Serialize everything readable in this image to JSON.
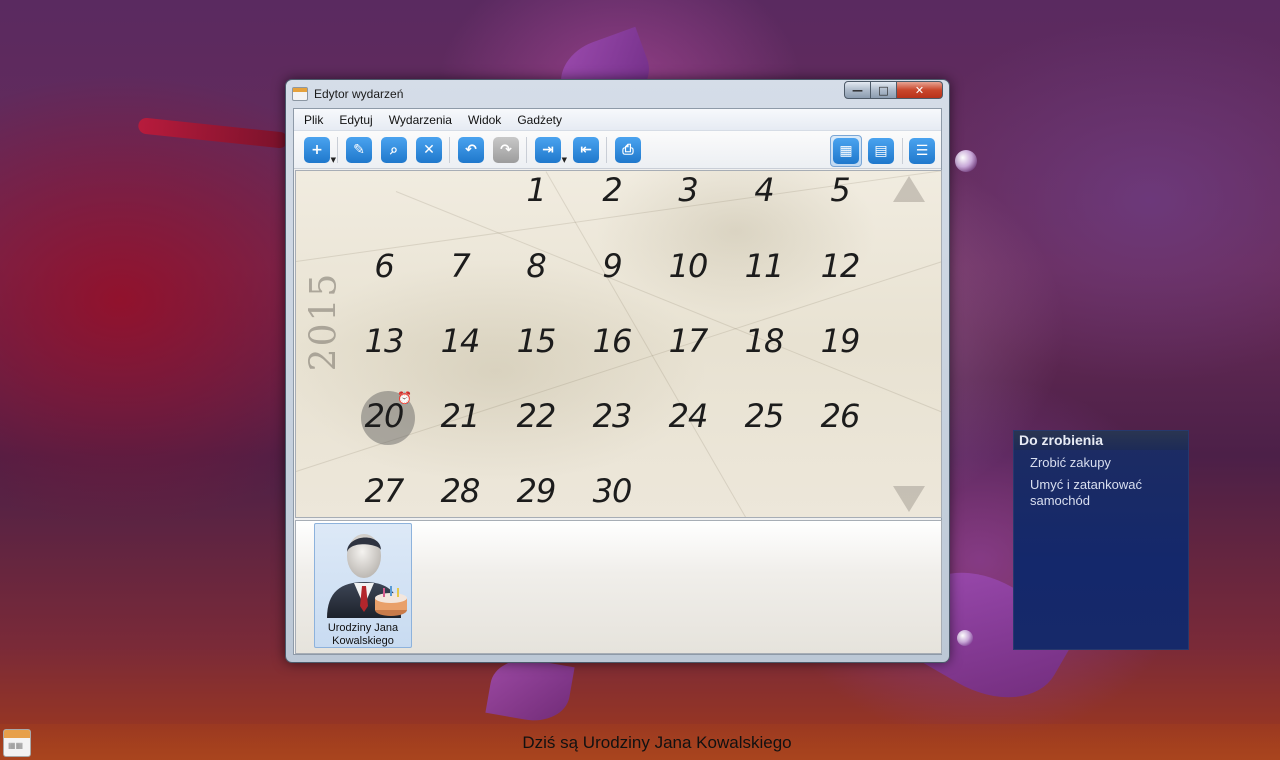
{
  "window": {
    "title": "Edytor wydarzeń",
    "controls": {
      "minimize": "—",
      "maximize": "□",
      "close": "✕"
    }
  },
  "menu": [
    "Plik",
    "Edytuj",
    "Wydarzenia",
    "Widok",
    "Gadżety"
  ],
  "toolbar": {
    "buttons": [
      {
        "name": "add-event-button",
        "icon": "plus-icon",
        "glyph": "+",
        "has_dropdown": true
      },
      {
        "name": "edit-button",
        "icon": "pencil-icon",
        "glyph": "✎"
      },
      {
        "name": "search-button",
        "icon": "magnifier-icon",
        "glyph": "⌕"
      },
      {
        "name": "delete-button",
        "icon": "x-icon",
        "glyph": "✕"
      },
      {
        "name": "undo-button",
        "icon": "undo-icon",
        "glyph": "↶"
      },
      {
        "name": "redo-button",
        "icon": "redo-icon",
        "glyph": "↷",
        "disabled": true
      },
      {
        "name": "export-button",
        "icon": "export-icon",
        "glyph": "⇥",
        "has_dropdown": true
      },
      {
        "name": "import-button",
        "icon": "import-icon",
        "glyph": "⇤"
      },
      {
        "name": "print-button",
        "icon": "printer-icon",
        "glyph": "⎙"
      }
    ],
    "view_buttons": [
      {
        "name": "month-view-button",
        "icon": "calendar-grid-icon",
        "glyph": "▦",
        "active": true
      },
      {
        "name": "week-view-button",
        "icon": "calendar-table-icon",
        "glyph": "▤"
      },
      {
        "name": "list-view-button",
        "icon": "tree-list-icon",
        "glyph": "☰"
      }
    ]
  },
  "calendar": {
    "year": "2015",
    "today": "20",
    "days": [
      [
        "",
        "",
        "1",
        "2",
        "3",
        "4",
        "5"
      ],
      [
        "6",
        "7",
        "8",
        "9",
        "10",
        "11",
        "12"
      ],
      [
        "13",
        "14",
        "15",
        "16",
        "17",
        "18",
        "19"
      ],
      [
        "20",
        "21",
        "22",
        "23",
        "24",
        "25",
        "26"
      ],
      [
        "27",
        "28",
        "29",
        "30",
        "",
        "",
        ""
      ]
    ],
    "alarm_icon": "⏰"
  },
  "events": [
    {
      "label": "Urodziny Jana\nKowalskiego",
      "icon": "person-with-cake-icon"
    }
  ],
  "todo": {
    "title": "Do zrobienia",
    "items": [
      "Zrobić zakupy",
      "Umyć i zatankować samochód"
    ]
  },
  "status": {
    "text": "Dziś są Urodziny Jana Kowalskiego"
  },
  "colors": {
    "accent": "#1f78cc",
    "todo_bg": "#14286b",
    "close_button": "#c9472c"
  }
}
